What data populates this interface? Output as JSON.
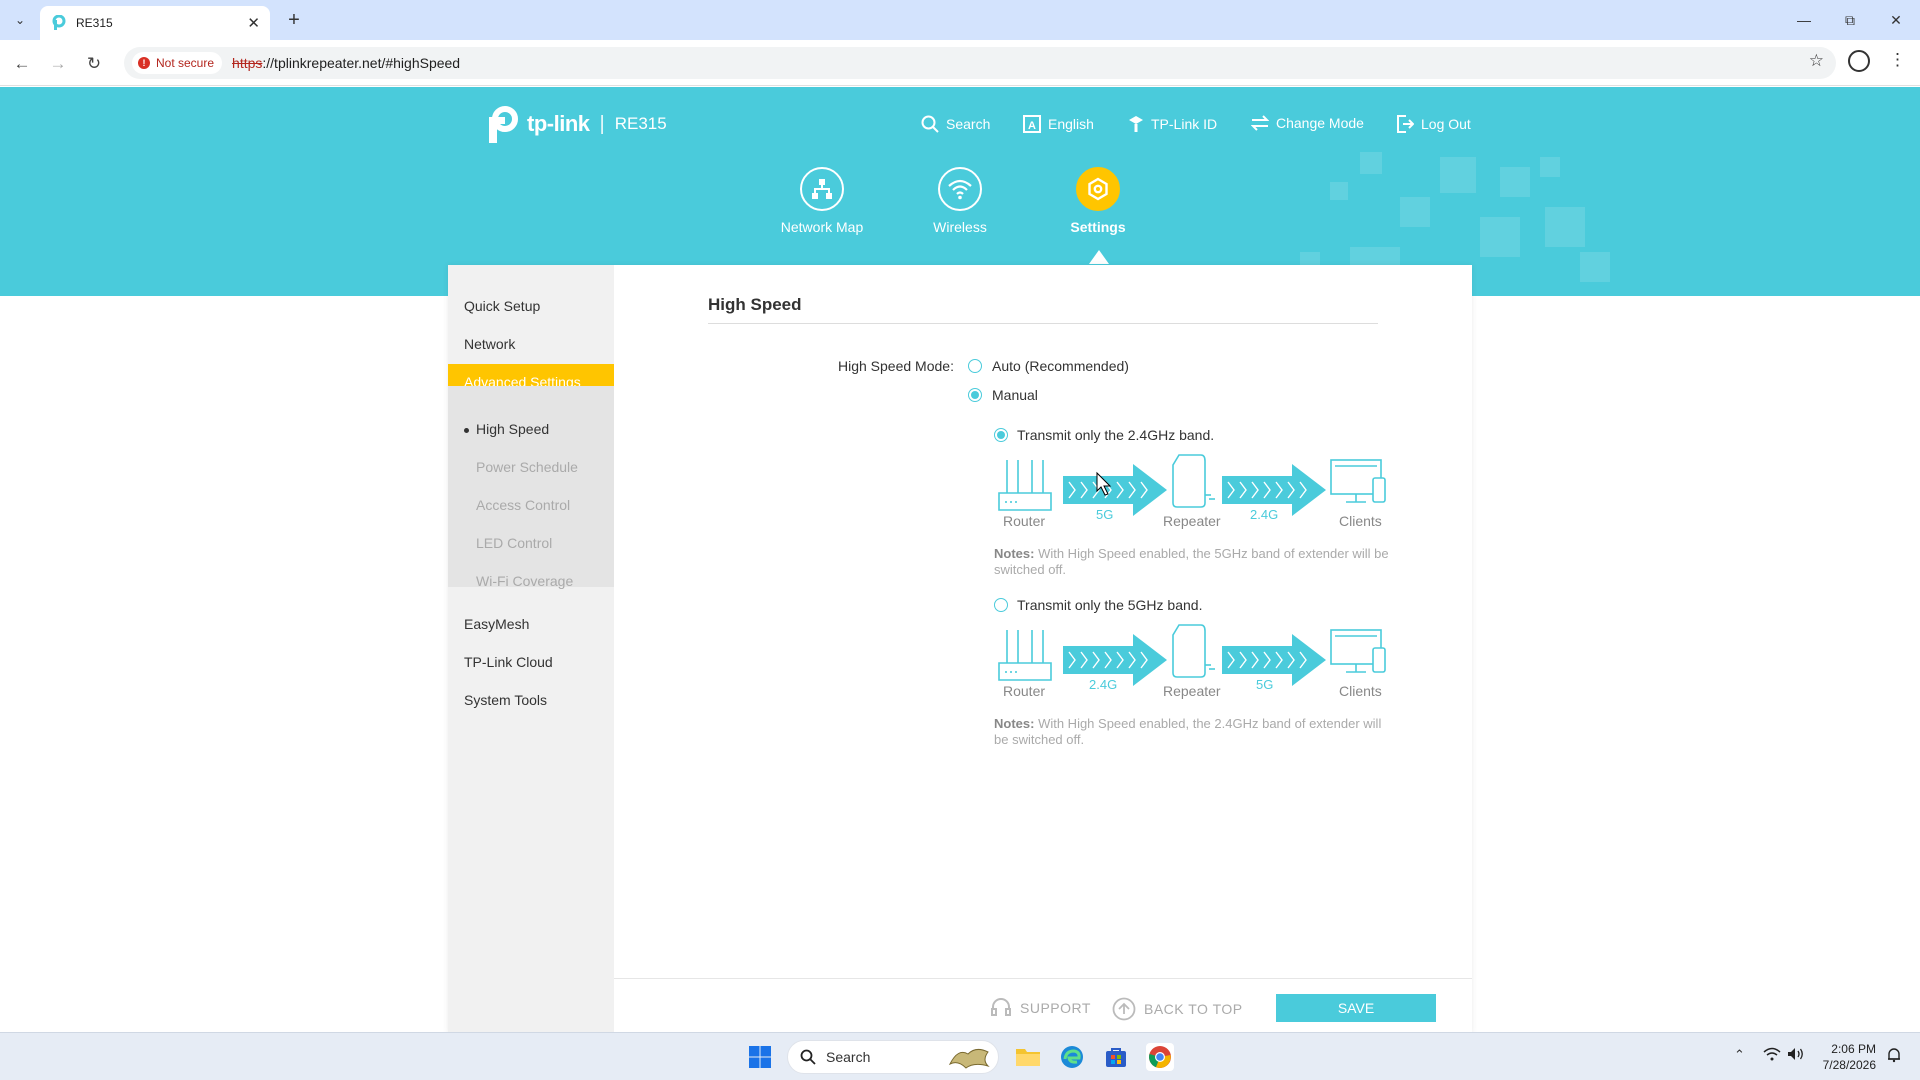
{
  "browser": {
    "tab_title": "RE315",
    "not_secure_label": "Not secure",
    "url_scheme": "https",
    "url_rest": "://tplinkrepeater.net/#highSpeed"
  },
  "header": {
    "brand": "tp-link",
    "model": "RE315",
    "topnav": {
      "search": "Search",
      "language": "English",
      "tplink_id": "TP-Link ID",
      "change_mode": "Change Mode",
      "logout": "Log Out"
    },
    "mainnav": {
      "network_map": "Network Map",
      "wireless": "Wireless",
      "settings": "Settings"
    }
  },
  "sidebar": {
    "quick_setup": "Quick Setup",
    "network": "Network",
    "advanced_settings": "Advanced Settings",
    "sub": {
      "high_speed": "High Speed",
      "power_schedule": "Power Schedule",
      "access_control": "Access Control",
      "led_control": "LED Control",
      "wifi_coverage": "Wi-Fi Coverage"
    },
    "easymesh": "EasyMesh",
    "tplink_cloud": "TP-Link Cloud",
    "system_tools": "System Tools"
  },
  "content": {
    "title": "High Speed",
    "mode_label": "High Speed Mode:",
    "options": {
      "auto": "Auto (Recommended)",
      "manual": "Manual"
    },
    "selected_mode": "Manual",
    "transmit_24": {
      "label": "Transmit only the 2.4GHz band.",
      "selected": true,
      "router": "Router",
      "band_in": "5G",
      "repeater": "Repeater",
      "band_out": "2.4G",
      "clients": "Clients",
      "notes_prefix": "Notes:",
      "notes_text": " With High Speed enabled, the 5GHz band of extender will be switched off."
    },
    "transmit_5": {
      "label": "Transmit only the 5GHz band.",
      "selected": false,
      "router": "Router",
      "band_in": "2.4G",
      "repeater": "Repeater",
      "band_out": "5G",
      "clients": "Clients",
      "notes_prefix": "Notes:",
      "notes_text": " With High Speed enabled, the 2.4GHz band of extender will be switched off."
    }
  },
  "footer": {
    "support": "SUPPORT",
    "back_to_top": "BACK TO TOP",
    "save": "SAVE"
  },
  "taskbar": {
    "search_label": "Search",
    "time": "2:06 PM",
    "date": "7/28/2026"
  },
  "colors": {
    "brand_teal": "#4acbdb",
    "accent_yellow": "#ffc500",
    "sidebar_bg": "#f1f1f1"
  }
}
